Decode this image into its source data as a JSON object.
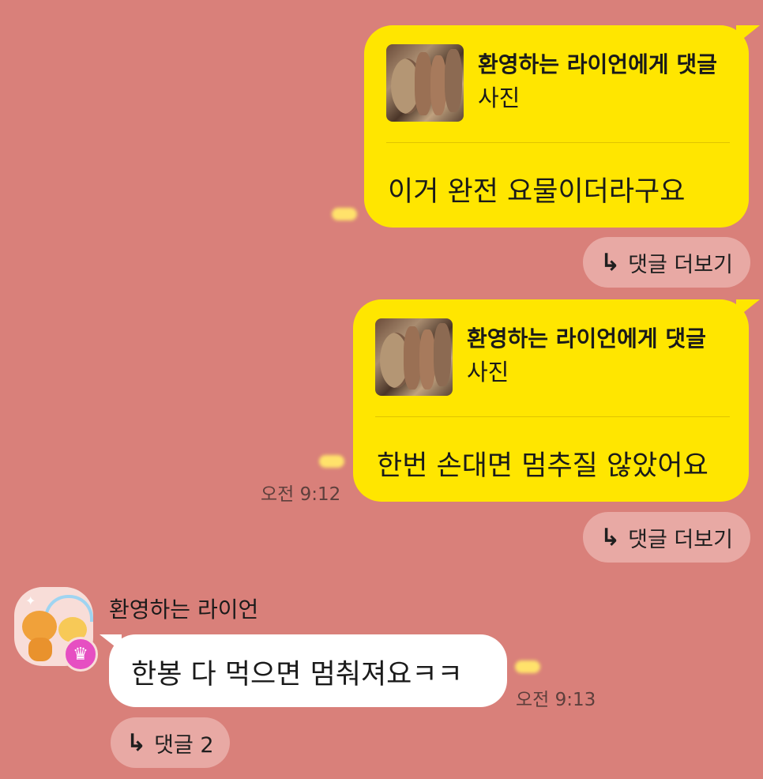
{
  "messages": [
    {
      "reply_to": "환영하는 라이언에게 댓글",
      "reply_type": "사진",
      "text": "이거 완전 요물이더라구요",
      "more_label": "댓글 더보기"
    },
    {
      "reply_to": "환영하는 라이언에게 댓글",
      "reply_type": "사진",
      "text": "한번 손대면 멈추질 않았어요",
      "time": "오전 9:12",
      "more_label": "댓글 더보기"
    }
  ],
  "incoming": {
    "sender": "환영하는 라이언",
    "text": "한봉 다 먹으면 멈춰져요ㅋㅋ",
    "time": "오전 9:13",
    "comments_label": "댓글 2"
  },
  "icons": {
    "reply_arrow": "reply-arrow-icon",
    "crown": "crown-icon"
  },
  "colors": {
    "background": "#d9807a",
    "outgoing_bubble": "#ffe600",
    "incoming_bubble": "#ffffff",
    "pill_button": "#e8a9a4",
    "crown_badge": "#e64fc2"
  }
}
